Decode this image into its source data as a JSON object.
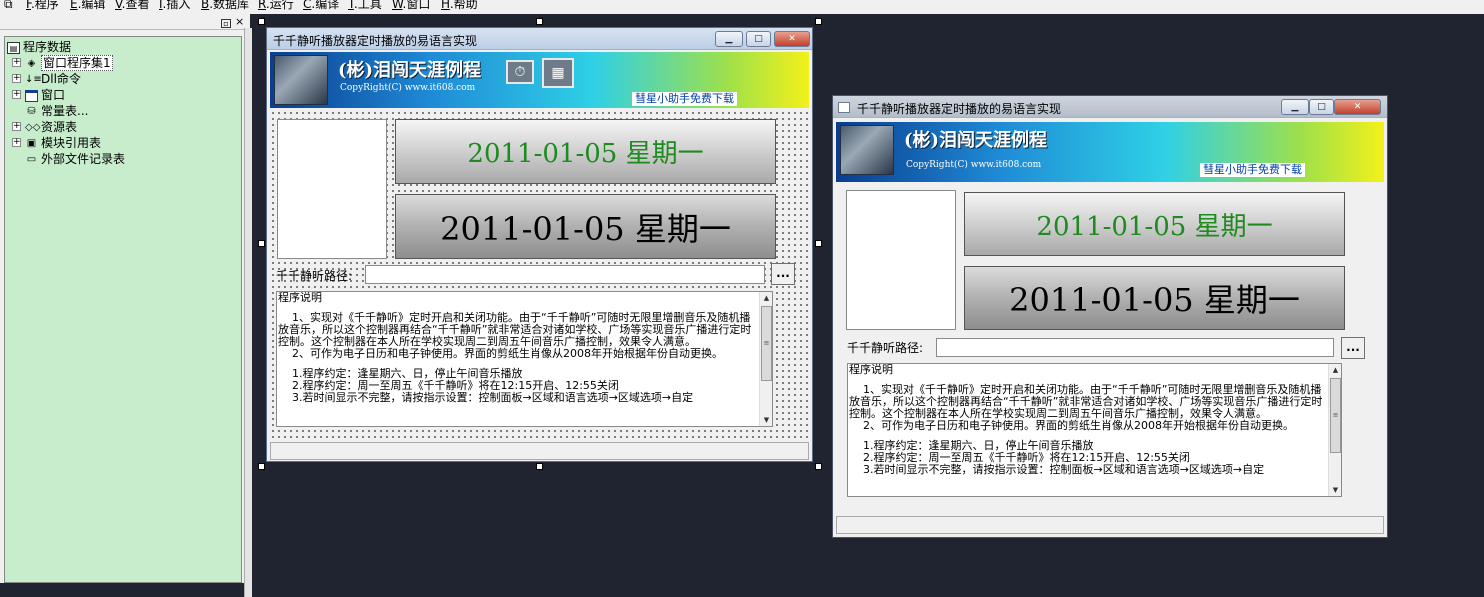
{
  "menu": [
    "F.程序",
    "E.编辑",
    "V.查看",
    "I.插入",
    "B.数据库",
    "R.运行",
    "C.编译",
    "T.工具",
    "W.窗口",
    "H.帮助"
  ],
  "menu_keys": [
    "F",
    "E",
    "V",
    "I",
    "B",
    "R",
    "C",
    "T",
    "W",
    "H"
  ],
  "menu_rest": [
    ".程序",
    ".编辑",
    ".查看",
    ".插入",
    ".数据库",
    ".运行",
    ".编译",
    ".工具",
    ".窗口",
    ".帮助"
  ],
  "panel": {
    "pin": "▫",
    "close": "×"
  },
  "tree": {
    "root": "程序数据",
    "items": [
      "窗口程序集1",
      "Dll命令",
      "窗口",
      "常量表...",
      "资源表",
      "模块引用表",
      "外部文件记录表"
    ]
  },
  "app": {
    "title": "千千静听播放器定时播放的易语言实现",
    "banner_title": "(彬)泪闯天涯例程",
    "copyright": "CopyRight(C) www.it608.com",
    "download": "彗星小助手免费下载",
    "date1": "2011-01-05  星期一",
    "date2": "2011-01-05  星期一",
    "path_label": "千千静听路径:",
    "browse": "...",
    "memo_title": "程序说明",
    "memo_p1": "    1、实现对《千千静听》定时开启和关闭功能。由于“千千静听”可随时无限里增删音乐及随机播放音乐，所以这个控制器再结合“千千静听”就非常适合对诸如学校、广场等实现音乐广播进行定时控制。这个控制器在本人所在学校实现周二到周五午间音乐广播控制，效果令人满意。",
    "memo_p2": "    2、可作为电子日历和电子钟使用。界面的剪纸生肖像从2008年开始根据年份自动更换。",
    "memo_l1": "    1.程序约定：逢星期六、日，停止午间音乐播放",
    "memo_l2": "    2.程序约定：周一至周五《千千静听》将在12:15开启、12:55关闭",
    "memo_l3": "    3.若时间显示不完整，请按指示设置：控制面板→区域和语言选项→区域选项→自定"
  },
  "colors": {
    "tree_bg": "#c7edcc",
    "date1_text": "#1f8a1f",
    "date2_text": "#000000",
    "download_text": "#003fa8",
    "designer_bg": "#1f2430"
  },
  "icons": {
    "clock": "⏱",
    "calendar": "▦",
    "min": "▁",
    "max": "□",
    "close": "✕"
  }
}
